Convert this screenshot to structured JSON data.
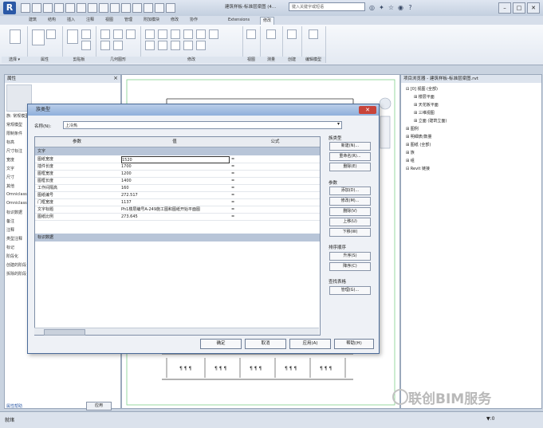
{
  "app": {
    "logo": "R",
    "title": "建筑样板-标准层梁图 (4...",
    "search_placeholder": "键入关键字或短语"
  },
  "ribbon_tabs": [
    "建筑",
    "结构",
    "插入",
    "注释",
    "视图",
    "管理",
    "附加模块",
    "修改",
    "协作",
    "Extensions",
    "修改"
  ],
  "ribbon_groups": [
    "选择 ▾",
    "属性",
    "剪贴板",
    "几何图形",
    "修改",
    "视图",
    "测量",
    "创建",
    "编辑模型"
  ],
  "properties": {
    "title": "属性",
    "close_icon": "×",
    "rows": [
      "族: 常规模型",
      "常规模型",
      "限制条件",
      "标高",
      "尺寸标注",
      "宽度",
      "文字",
      "尺寸",
      "其他",
      "Omniclass",
      "Omniclass",
      "标识数据",
      "备注",
      "注释",
      "类型注释",
      "标记",
      "阶段化",
      "创建的阶段",
      "拆除的阶段"
    ],
    "help_link": "属性帮助",
    "apply": "应用"
  },
  "browser": {
    "title": "项目浏览器 - 建筑样板-标准层梁图.rvt",
    "items": [
      {
        "label": "⊟ [0] 视图 (全部)",
        "indent": 0
      },
      {
        "label": "⊞ 楼层平面",
        "indent": 1
      },
      {
        "label": "⊞ 天花板平面",
        "indent": 1
      },
      {
        "label": "⊞ 三维视图",
        "indent": 1
      },
      {
        "label": "⊞ 立面 (建筑立面)",
        "indent": 1
      },
      {
        "label": "⊞ 图例",
        "indent": 0
      },
      {
        "label": "⊞ 明细表/数量",
        "indent": 0
      },
      {
        "label": "⊞ 图纸 (全部)",
        "indent": 0
      },
      {
        "label": "⊞ 族",
        "indent": 0
      },
      {
        "label": "⊞ 组",
        "indent": 0
      },
      {
        "label": "⊟ Revit 链接",
        "indent": 0
      }
    ]
  },
  "dialog": {
    "title": "族类型",
    "close": "✕",
    "family_label": "名称(N):",
    "family_value": "上冷热",
    "columns": [
      "参数",
      "值",
      "公式"
    ],
    "sections": [
      "文字",
      "标识数据"
    ],
    "rows": [
      {
        "param": "图纸宽度",
        "value": "1520",
        "formula": "="
      },
      {
        "param": "插件长度",
        "value": "1700",
        "formula": "="
      },
      {
        "param": "图框宽度",
        "value": "1200",
        "formula": "="
      },
      {
        "param": "图框长度",
        "value": "1400",
        "formula": "="
      },
      {
        "param": "工作间隔高",
        "value": "160",
        "formula": "="
      },
      {
        "param": "图纸编号",
        "value": "272.517",
        "formula": "="
      },
      {
        "param": "门框宽度",
        "value": "1137",
        "formula": "="
      },
      {
        "param": "文字标题",
        "value": "Ph1楼层编号A-249施工图和图纸开始平面图",
        "formula": "="
      },
      {
        "param": "图纸比例",
        "value": "273.645",
        "formula": "="
      }
    ],
    "group_types": "族类型",
    "type_btns": [
      "新建(N)...",
      "重命名(R)...",
      "删除(E)"
    ],
    "group_params": "参数",
    "param_btns": [
      "添加(D)...",
      "修改(M)...",
      "删除(V)",
      "上移(U)",
      "下移(W)"
    ],
    "group_sort": "排序顺序",
    "sort_btns": [
      "升序(S)",
      "降序(C)"
    ],
    "group_lookup": "查找表格",
    "lookup_btns": [
      "管理(G)..."
    ],
    "footer": [
      "确定",
      "取消",
      "应用(A)",
      "帮助(H)"
    ]
  },
  "status": {
    "left": "就绪",
    "filter": "▼:0"
  },
  "watermark": "联创BIM服务"
}
